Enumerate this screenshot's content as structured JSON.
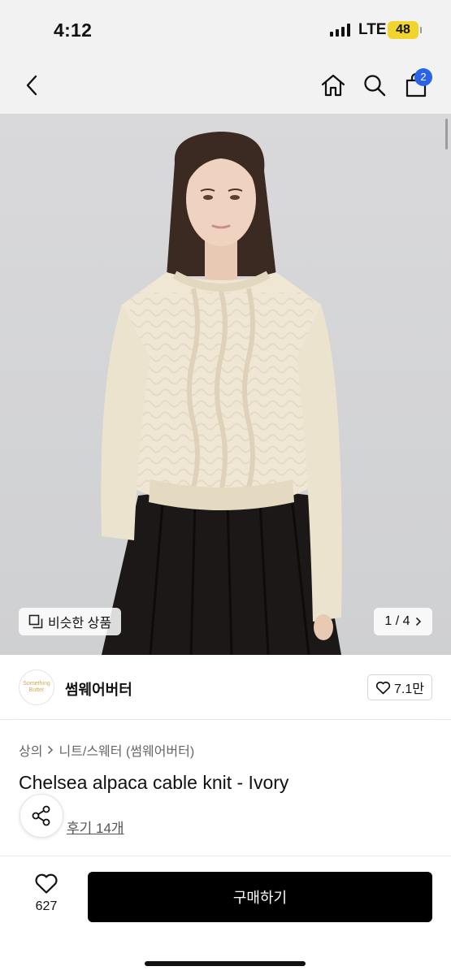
{
  "status_bar": {
    "time": "4:12",
    "network": "LTE",
    "battery": "48"
  },
  "nav": {
    "cart_count": "2",
    "icons": [
      "back-icon",
      "home-icon",
      "search-icon",
      "cart-icon"
    ]
  },
  "gallery": {
    "similar_label": "비슷한 상품",
    "page_indicator": "1 / 4",
    "image_description": "model wearing ivory cable knit sweater and black skirt"
  },
  "brand": {
    "logo_text": "Something Butter",
    "name": "썸웨어버터",
    "likes": "7.1만"
  },
  "breadcrumb": [
    "상의",
    "니트/스웨터 (썸웨어버터)"
  ],
  "product": {
    "title": "Chelsea alpaca cable knit - Ivory",
    "reviews": "후기 14개"
  },
  "bottom_bar": {
    "wish_count": "627",
    "buy_label": "구매하기"
  },
  "colors": {
    "accent_badge": "#2b63e8",
    "buy_button": "#000000",
    "battery": "#f2d52c"
  }
}
